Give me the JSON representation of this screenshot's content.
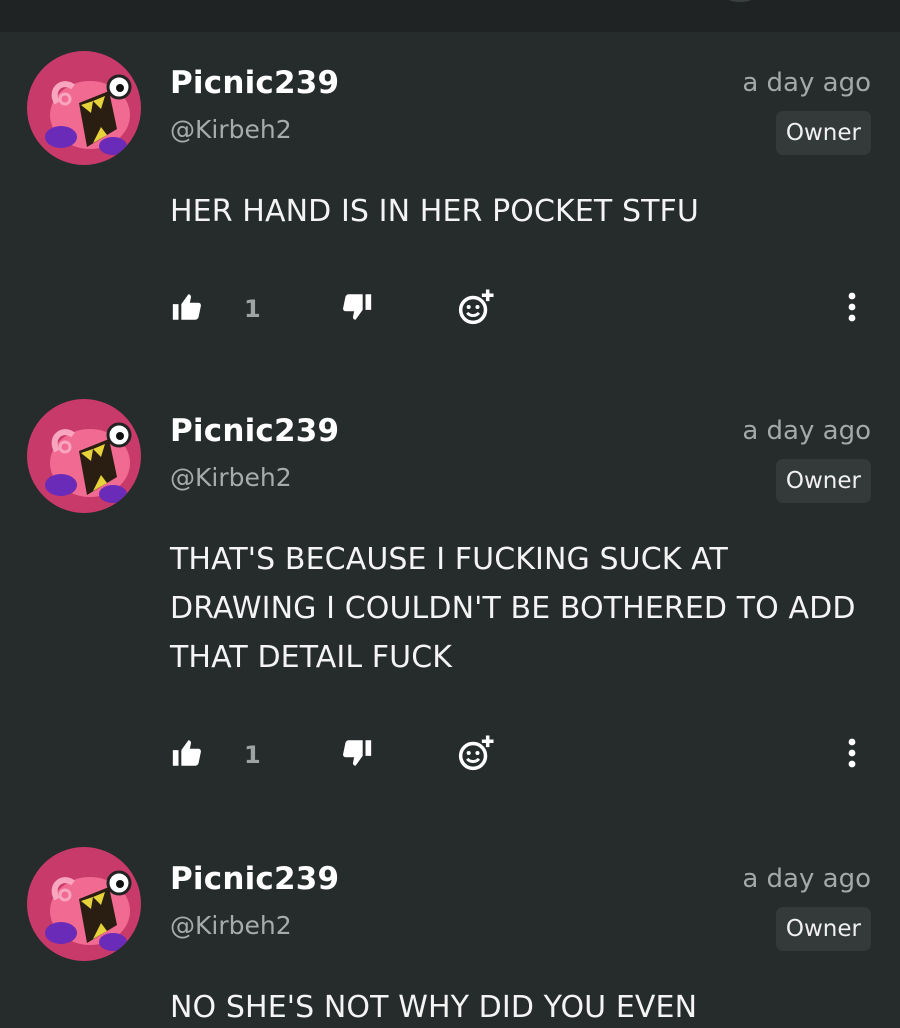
{
  "colors": {
    "background": "#262b2b",
    "avatar_bg": "#c83a6a",
    "text_primary": "#ffffff",
    "text_secondary": "#a7abab",
    "badge_bg": "#343a3a"
  },
  "icons": [
    "thumbs-up-icon",
    "thumbs-down-icon",
    "add-reaction-icon",
    "more-vertical-icon"
  ],
  "comments": [
    {
      "username": "Picnic239",
      "handle": "@Kirbeh2",
      "timestamp": "a day ago",
      "badge": "Owner",
      "text": "HER HAND IS IN HER POCKET STFU",
      "likes": "1"
    },
    {
      "username": "Picnic239",
      "handle": "@Kirbeh2",
      "timestamp": "a day ago",
      "badge": "Owner",
      "text": "THAT'S BECAUSE I FUCKING SUCK AT DRAWING I COULDN'T BE BOTHERED TO ADD THAT DETAIL FUCK",
      "likes": "1"
    },
    {
      "username": "Picnic239",
      "handle": "@Kirbeh2",
      "timestamp": "a day ago",
      "badge": "Owner",
      "text": "NO SHE'S NOT WHY DID YOU EVEN"
    }
  ]
}
